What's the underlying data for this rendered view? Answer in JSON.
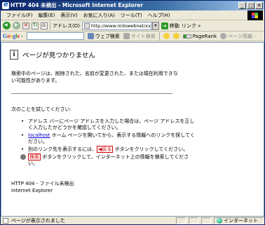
{
  "window": {
    "title": "HTTP 404 未検出 - Microsoft Internet Explorer",
    "buttons": {
      "minimize": "_",
      "maximize": "□",
      "close": "✕"
    }
  },
  "menubar": {
    "items": [
      "ファイル(F)",
      "編集(E)",
      "表示(V)",
      "お気に入り(A)",
      "ツール(T)",
      "ヘルプ(H)"
    ]
  },
  "toolbar": {
    "address_label": "アドレス(D)",
    "address_value": "http://www.milowebnet/xxx",
    "go_label": "移動",
    "links_label": "リンク »"
  },
  "googlebar": {
    "logo": "Google -",
    "search_value": "",
    "web_search": "ウェブ検索",
    "site_search": "サイト検索",
    "pagerank": "PageRank",
    "page_info": "ページ情報 -"
  },
  "content": {
    "title": "ページが見つかりません",
    "paragraph1": "検索中のページは、削除された、名前が変更された、または現在利用できない可能性があります。",
    "paragraph2": "次のことを試してください:",
    "bullets": [
      {
        "text": "アドレス バーにページ アドレスを入力した場合は、ページ アドレスを正しく入力したかどうかを確認してください。"
      },
      {
        "link": "localhost",
        "text": " ホーム ページを開いてから、表示する情報へのリンクを探してください。"
      },
      {
        "pre": "別のリンク先を表示するには、",
        "button": "戻る",
        "post": " ボタンをクリックしてください。"
      },
      {
        "button": "検索",
        "post": " ボタンをクリックして、インターネット上の情報を検索してください。"
      }
    ],
    "footer_line1": "HTTP 404 - ファイル未検出",
    "footer_line2": "Internet Explorer"
  },
  "statusbar": {
    "text": "ページが表示されました",
    "zone": "インターネット"
  }
}
